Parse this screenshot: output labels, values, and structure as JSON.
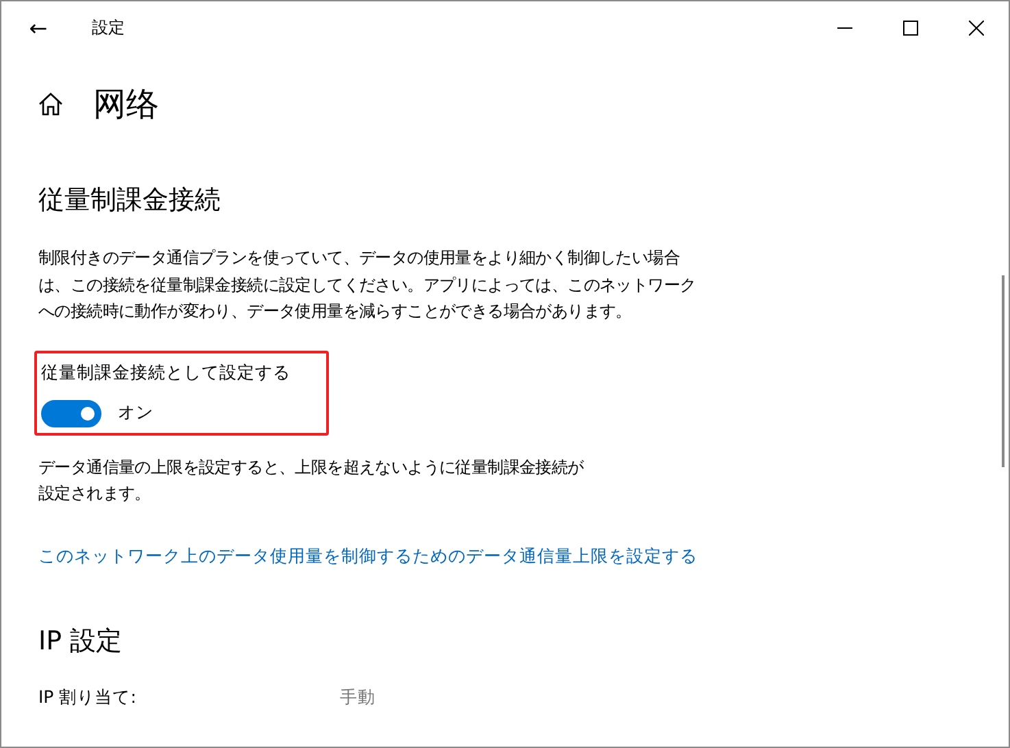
{
  "window": {
    "title": "設定",
    "back": "←"
  },
  "page": {
    "title": "网络"
  },
  "metered": {
    "heading": "従量制課金接続",
    "description": "制限付きのデータ通信プランを使っていて、データの使用量をより細かく制御したい場合は、この接続を従量制課金接続に設定してください。アプリによっては、このネットワークへの接続時に動作が変わり、データ使用量を減らすことができる場合があります。",
    "toggle": {
      "label": "従量制課金接続として設定する",
      "on": true,
      "state_text": "オン",
      "highlighted": true
    },
    "note": "データ通信量の上限を設定すると、上限を超えないように従量制課金接続が設定されます。",
    "link": "このネットワーク上のデータ使用量を制御するためのデータ通信量上限を設定する"
  },
  "ip": {
    "heading": "IP 設定",
    "rows": [
      {
        "label": "IP 割り当て:",
        "value": "手動"
      }
    ]
  }
}
